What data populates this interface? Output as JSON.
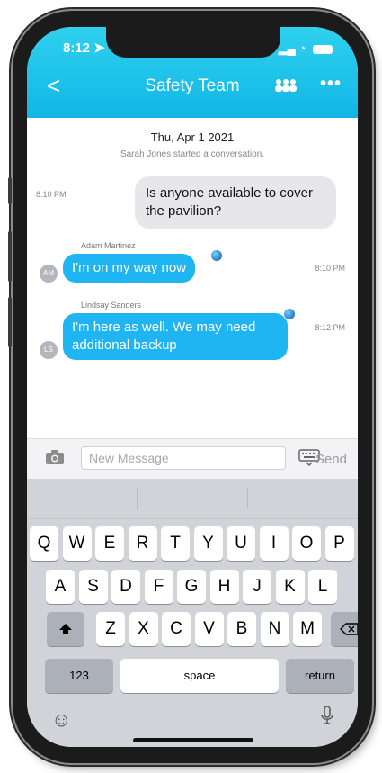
{
  "status_bar": {
    "time": "8:12",
    "signal": "..",
    "wifi": "wifi"
  },
  "header": {
    "back": "<",
    "title": "Safety Team",
    "more": "•••"
  },
  "chat": {
    "date": "Thu, Apr 1 2021",
    "started": "Sarah Jones started a conversation.",
    "messages": [
      {
        "time": "8:10 PM",
        "text": "Is anyone available to cover the pavilion?"
      },
      {
        "sender": "Adam Martinez",
        "initials": "AM",
        "text": "I'm on my way now",
        "time": "8:10 PM"
      },
      {
        "sender": "Lindsay Sanders",
        "initials": "LS",
        "text": "I'm here as well. We may need additional backup",
        "time": "8:12 PM"
      }
    ]
  },
  "compose": {
    "placeholder": "New Message",
    "send": "Send"
  },
  "keyboard": {
    "row1": [
      "Q",
      "W",
      "E",
      "R",
      "T",
      "Y",
      "U",
      "I",
      "O",
      "P"
    ],
    "row2": [
      "A",
      "S",
      "D",
      "F",
      "G",
      "H",
      "J",
      "K",
      "L"
    ],
    "row3": [
      "Z",
      "X",
      "C",
      "V",
      "B",
      "N",
      "M"
    ],
    "numbers": "123",
    "space": "space",
    "return": "return"
  }
}
